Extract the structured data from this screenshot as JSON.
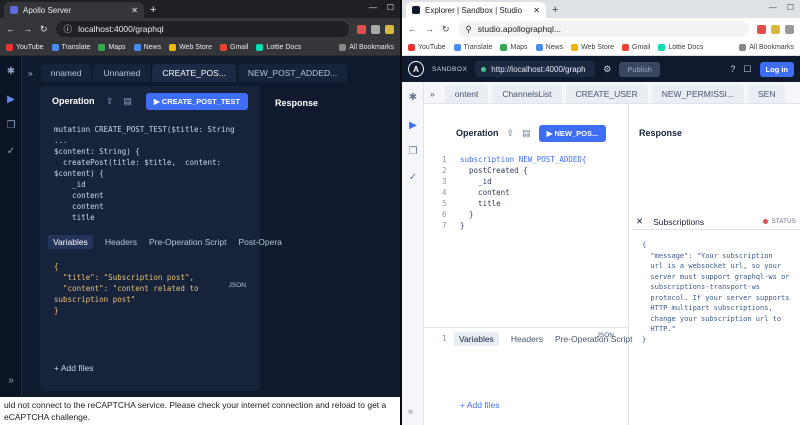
{
  "left_window": {
    "tab_title": "Apollo Server",
    "address": "localhost:4000/graphql",
    "bookmarks": [
      "YouTube",
      "Translate",
      "Maps",
      "News",
      "Web Store",
      "Gmail",
      "Lottie Docs",
      "All Bookmarks"
    ],
    "op_tabs": [
      "nnamed",
      "Unnamed",
      "CREATE_POS...",
      "NEW_POST_ADDED..."
    ],
    "operation_label": "Operation",
    "run_button": "CREATE_POST_TEST",
    "response_label": "Response",
    "code_lines": [
      "mutation CREATE_POST_TEST($title: String ...",
      "$content: String) {",
      "  createPost(title: $title,  content:",
      "$content) {",
      "    _id",
      "    content",
      "    content",
      "    title"
    ],
    "variables_tabs": [
      "Variables",
      "Headers",
      "Pre-Operation Script",
      "Post-Opera"
    ],
    "json_label": "JSON",
    "variables_lines": [
      "{",
      "  \"title\": \"Subscription post\",",
      "  \"content\": \"content related to",
      "subscription post\"",
      "}"
    ],
    "add_files": "+ Add files",
    "error_text_1": "uld not connect to the reCAPTCHA service. Please check your internet connection and reload to get a",
    "error_text_2": "eCAPTCHA challenge."
  },
  "right_window": {
    "tab_title": "Explorer | Sandbox | Studio",
    "address": "studio.apollographql...",
    "bookmarks": [
      "YouTube",
      "Translate",
      "Maps",
      "News",
      "Web Store",
      "Gmail",
      "Lottie Docs",
      "All Bookmarks"
    ],
    "sandbox_label": "SANDBOX",
    "endpoint": "http://localhost:4000/graph",
    "publish_button": "Publish",
    "login_button": "Log in",
    "op_tabs": [
      "ontent",
      "ChannelsList",
      "CREATE_USER",
      "NEW_PERMISSI...",
      "SEN"
    ],
    "operation_label": "Operation",
    "run_button": "NEW_POS...",
    "response_label": "Response",
    "code_lines": [
      "subscription NEW_POST_ADDED{",
      "  postCreated {",
      "    _id",
      "    content",
      "    title",
      "  }",
      "}"
    ],
    "subscriptions_label": "Subscriptions",
    "status_label": "STATUS",
    "message_lines": [
      "{",
      "  \"message\": \"Your subscription",
      "  url is a websocket url, so your",
      "  server must support graphql-ws or",
      "  subscriptions-transport-ws",
      "  protocol. If your server supports",
      "  HTTP multipart subscriptions,",
      "  change your subscription url to",
      "  HTTP.\"",
      "}"
    ],
    "variables_tabs": [
      "Variables",
      "Headers",
      "Pre-Operation Script"
    ],
    "json_label": "JSON",
    "add_files": "+ Add files"
  }
}
